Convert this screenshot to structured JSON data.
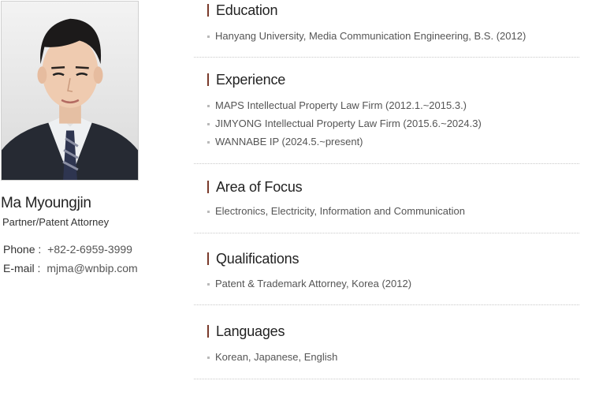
{
  "profile": {
    "name": "Ma Myoungjin",
    "role": "Partner/Patent Attorney",
    "phone_label": "Phone :",
    "phone": "+82-2-6959-3999",
    "email_label": "E-mail :",
    "email": "mjma@wnbip.com"
  },
  "sections": [
    {
      "title": "Education",
      "items": [
        "Hanyang University, Media Communication Engineering, B.S. (2012)"
      ]
    },
    {
      "title": "Experience",
      "items": [
        "MAPS Intellectual Property Law Firm (2012.1.~2015.3.)",
        "JIMYONG Intellectual Property Law Firm (2015.6.~2024.3)",
        "WANNABE IP (2024.5.~present)"
      ]
    },
    {
      "title": "Area of Focus",
      "items": [
        "Electronics, Electricity, Information and Communication"
      ]
    },
    {
      "title": "Qualifications",
      "items": [
        "Patent & Trademark Attorney, Korea (2012)"
      ]
    },
    {
      "title": "Languages",
      "items": [
        "Korean, Japanese, English"
      ]
    }
  ],
  "colors": {
    "accent_bar": "#7a3a2a",
    "bullet": "#b9b9b9",
    "divider": "#c9c9c9"
  }
}
